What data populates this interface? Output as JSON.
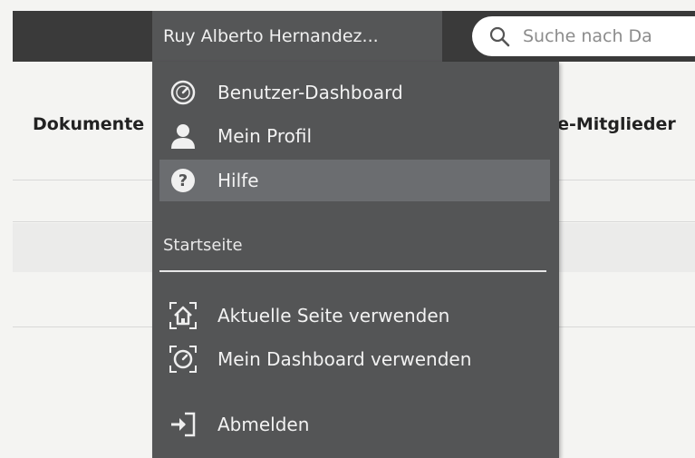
{
  "header": {
    "user_name": "Ruy Alberto Hernandez...",
    "search_placeholder": "Suche nach Da"
  },
  "background": {
    "left_heading": "Dokumente",
    "right_heading": "te-Mitglieder"
  },
  "menu": {
    "items": [
      {
        "label": "Benutzer-Dashboard",
        "icon": "dashboard-icon"
      },
      {
        "label": "Mein Profil",
        "icon": "user-icon"
      },
      {
        "label": "Hilfe",
        "icon": "help-icon",
        "highlighted": true
      }
    ],
    "section_label": "Startseite",
    "home_items": [
      {
        "label": "Aktuelle Seite verwenden",
        "icon": "home-icon"
      },
      {
        "label": "Mein Dashboard verwenden",
        "icon": "dashboard-icon"
      }
    ],
    "logout": {
      "label": "Abmelden",
      "icon": "logout-icon"
    }
  },
  "colors": {
    "header_bg": "#3a3a3a",
    "menu_bg": "#545556",
    "highlight_bg": "#6b6d70",
    "text": "#f2f2f2"
  }
}
